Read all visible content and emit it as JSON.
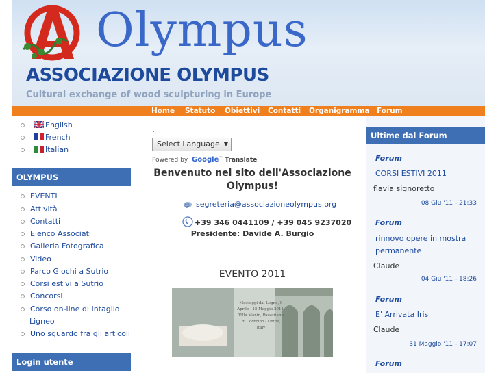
{
  "header": {
    "brand": "Olympus",
    "site_title": "ASSOCIAZIONE OLYMPUS",
    "tagline": "Cultural exchange of wood sculpturing in Europe"
  },
  "nav": [
    "Home",
    "Statuto",
    "Obiettivi",
    "Contatti",
    "Organigramma",
    "Forum"
  ],
  "languages": [
    "English",
    "French",
    "Italian"
  ],
  "olympus_menu": {
    "title": "OLYMPUS",
    "items": [
      "EVENTI",
      "Attività",
      "Contatti",
      "Elenco Associati",
      "Galleria Fotografica",
      "Video",
      "Parco Giochi a Sutrio",
      "Corsi estivi a Sutrio",
      "Concorsi",
      "Corso on-line di Intaglio",
      "Ligneo",
      "Uno sguardo fra gli articoli"
    ]
  },
  "login": {
    "title": "Login utente"
  },
  "translate": {
    "dot": ".",
    "select_label": "Select Language",
    "powered_by": "Powered by",
    "google": "Google",
    "translate": "Translate"
  },
  "main": {
    "welcome_line1": "Benvenuto nel sito dell'Associazione",
    "welcome_line2": "Olympus!",
    "email": "segreteria@associazioneolympus.org",
    "phones": "+39 346 0441109 / +39 045 9237020",
    "president": "Presidente: Davide A. Burgio",
    "event_title": "EVENTO 2011",
    "event_image_caption": "Messaggi dal Legno, 9 Aprile - 15 Maggio 2011, Villa Manin, Passariano di Codroipo - Udine, Italy"
  },
  "forum": {
    "title": "Ultime dal Forum",
    "posts": [
      {
        "category": "Forum",
        "title": "CORSI ESTIVI 2011",
        "author": "flavia signoretto",
        "date": "08 Giu '11 - 21:33"
      },
      {
        "category": "Forum",
        "title": "rinnovo opere in mostra permanente",
        "author": "Claude",
        "date": "04 Giu '11 - 18:26"
      },
      {
        "category": "Forum",
        "title": "E' Arrivata Iris",
        "author": "Claude",
        "date": "31 Maggio '11 - 17:07"
      },
      {
        "category": "Forum",
        "title": "",
        "author": "",
        "date": ""
      }
    ]
  },
  "colors": {
    "accent_orange": "#f07f1d",
    "box_blue": "#3e6fb4",
    "link_blue": "#1d4a9c",
    "logo_red": "#d42a1e"
  }
}
